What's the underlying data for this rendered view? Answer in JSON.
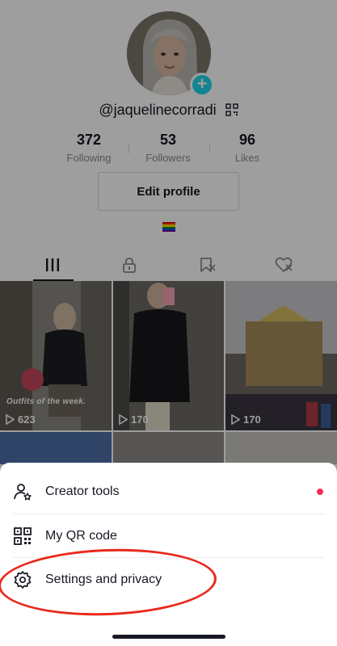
{
  "profile": {
    "username": "@jaquelinecorradi",
    "stats": [
      {
        "value": "372",
        "label": "Following"
      },
      {
        "value": "53",
        "label": "Followers"
      },
      {
        "value": "96",
        "label": "Likes"
      }
    ],
    "edit_button": "Edit profile",
    "bio_emoji": "rainbow-flag",
    "tabs": [
      {
        "name": "videos-tab",
        "icon": "grid-bars-icon",
        "active": true
      },
      {
        "name": "private-tab",
        "icon": "lock-icon"
      },
      {
        "name": "favorites-tab",
        "icon": "bookmark-icon"
      },
      {
        "name": "liked-tab",
        "icon": "heart-icon"
      }
    ]
  },
  "grid": {
    "videos": [
      {
        "views": "623",
        "caption": "Outfits of the week."
      },
      {
        "views": "170",
        "caption": ""
      },
      {
        "views": "170",
        "caption": ""
      }
    ]
  },
  "sheet": {
    "items": [
      {
        "label": "Creator tools",
        "icon": "creator-tools-icon",
        "has_dot": true
      },
      {
        "label": "My QR code",
        "icon": "qr-code-icon",
        "has_dot": false
      },
      {
        "label": "Settings and privacy",
        "icon": "settings-gear-icon",
        "has_dot": false
      }
    ]
  },
  "colors": {
    "accent_teal": "#20d5ec",
    "notification_red": "#fe2c55",
    "highlight_ring": "#e8291c"
  }
}
